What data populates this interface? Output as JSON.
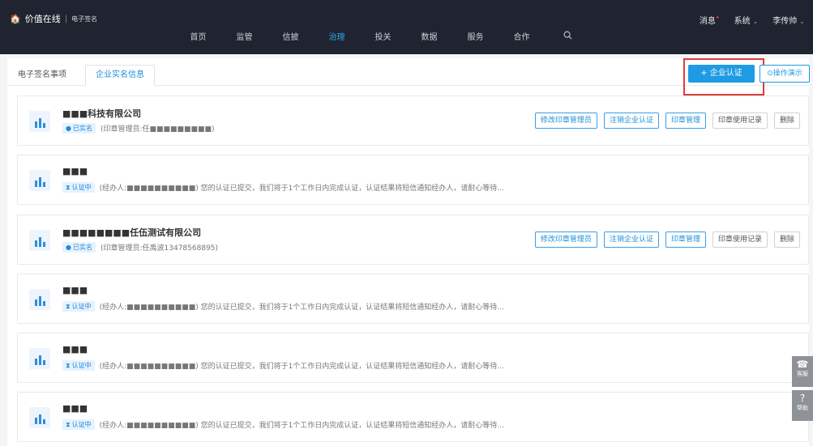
{
  "header": {
    "brand": "价值在线",
    "separator": "|",
    "sub": "电子签名",
    "right": [
      {
        "label": "消息",
        "mark": "•"
      },
      {
        "label": "系统",
        "caret": "⌄"
      },
      {
        "label": "李传帅",
        "caret": "⌄"
      }
    ]
  },
  "nav": {
    "items": [
      "首页",
      "监管",
      "信披",
      "治理",
      "投关",
      "数据",
      "服务",
      "合作"
    ],
    "active_index": 3,
    "search_icon": "search-icon"
  },
  "tabs": {
    "first": "电子签名事项",
    "second": "企业实名信息"
  },
  "toolbar": {
    "add_label": "+ 企业认证",
    "demo_label": "⊙操作演示"
  },
  "cards": [
    {
      "name": "■■■科技有限公司",
      "status": "已实名",
      "status_kind": "ok",
      "meta": "(印章管理员:任■■■■■■■■■)",
      "actions": true
    },
    {
      "name": "■■■",
      "status": "认证中",
      "status_kind": "pending",
      "meta": "(经办人:■■■■■■■■■■) 您的认证已提交，我们将于1个工作日内完成认证，认证结果将短信通知经办人，请耐心等待...",
      "actions": false
    },
    {
      "name": "■■■■■■■■任伍测试有限公司",
      "status": "已实名",
      "status_kind": "ok",
      "meta": "(印章管理员:任禹波13478568895)",
      "actions": true
    },
    {
      "name": "■■■",
      "status": "认证中",
      "status_kind": "pending",
      "meta": "(经办人:■■■■■■■■■■) 您的认证已提交，我们将于1个工作日内完成认证，认证结果将短信通知经办人，请耐心等待...",
      "actions": false
    },
    {
      "name": "■■■",
      "status": "认证中",
      "status_kind": "pending",
      "meta": "(经办人:■■■■■■■■■■) 您的认证已提交，我们将于1个工作日内完成认证，认证结果将短信通知经办人，请耐心等待...",
      "actions": false
    },
    {
      "name": "■■■",
      "status": "认证中",
      "status_kind": "pending",
      "meta": "(经办人:■■■■■■■■■■) 您的认证已提交，我们将于1个工作日内完成认证，认证结果将短信通知经办人，请耐心等待...",
      "actions": false
    }
  ],
  "card_actions": [
    "修改印章管理员",
    "注销企业认证",
    "印章管理",
    "印章使用记录",
    "删除"
  ],
  "floating": [
    {
      "icon": "customer-service-icon",
      "label": "客服"
    },
    {
      "icon": "help-icon",
      "label": "帮助"
    }
  ],
  "colors": {
    "topbar": "#1f2430",
    "accent": "#1e9be4",
    "highlight": "#e03b3b"
  }
}
